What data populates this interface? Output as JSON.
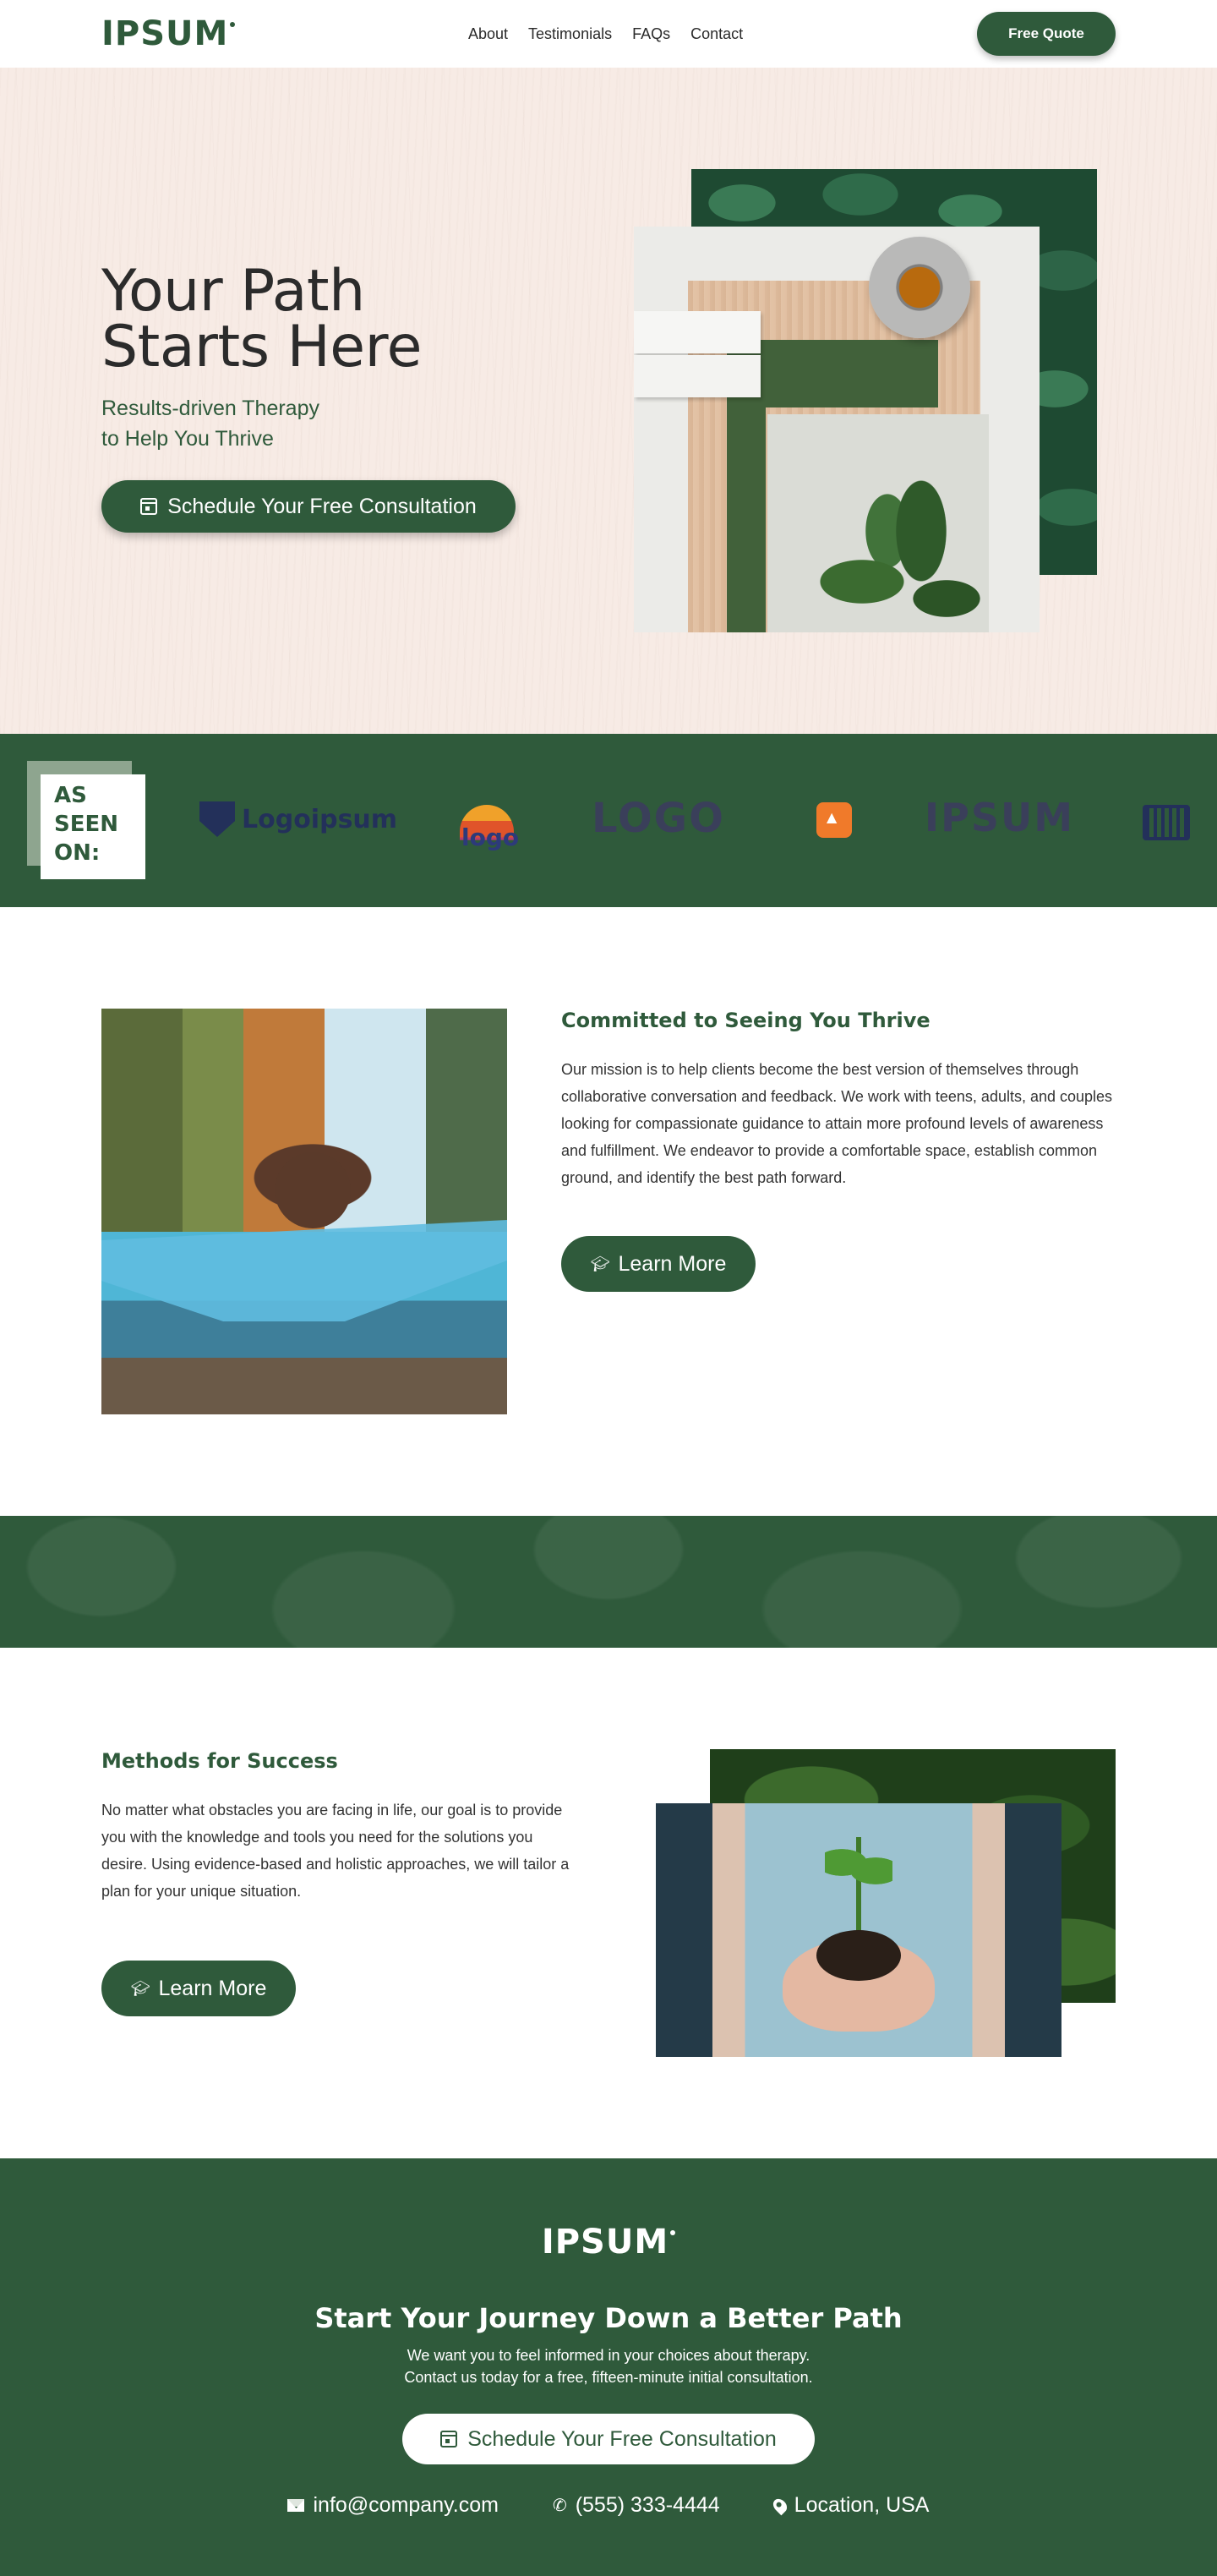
{
  "header": {
    "logo": "IPSUM",
    "nav": [
      "About",
      "Testimonials",
      "FAQs",
      "Contact"
    ],
    "cta": "Free Quote"
  },
  "hero": {
    "title_line1": "Your Path",
    "title_line2": "Starts Here",
    "subtitle_line1": "Results-driven Therapy",
    "subtitle_line2": "to Help You Thrive",
    "cta": "Schedule Your Free Consultation"
  },
  "seen": {
    "label_line1": "AS",
    "label_line2": "SEEN",
    "label_line3": "ON:",
    "partners": [
      "Logoipsum",
      "logo",
      "LOGO",
      "IPSUM"
    ]
  },
  "committed": {
    "title": "Committed to Seeing You Thrive",
    "body": "Our mission is to help clients become the best version of themselves through collaborative conversation and feedback. We work with teens, adults, and couples looking for compassionate guidance to attain more profound levels of awareness and fulfillment. We endeavor to provide a comfortable space, establish common ground, and identify the best path forward.",
    "cta": "Learn More"
  },
  "methods": {
    "title": "Methods for Success",
    "body": "No matter what obstacles you are facing in life, our goal is to provide you with the knowledge and tools you need for the solutions you desire. Using evidence-based and holistic approaches, we will tailor a plan for your unique situation.",
    "cta": "Learn More"
  },
  "footer": {
    "logo": "IPSUM",
    "title": "Start Your Journey Down a Better Path",
    "desc_line1": "We want you to feel informed in your choices about therapy.",
    "desc_line2": "Contact us today for a free, fifteen-minute initial consultation.",
    "cta": "Schedule Your Free Consultation",
    "email": "info@company.com",
    "phone": "(555) 333-4444",
    "location": "Location, USA"
  },
  "colors": {
    "brand_green": "#2f5a3b",
    "hero_bg": "#f7ebe5"
  }
}
